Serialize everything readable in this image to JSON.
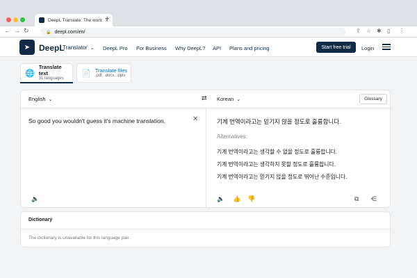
{
  "browser": {
    "tab_title": "DeepL Translate: The world's",
    "tab_close": "×",
    "new_tab": "+",
    "url": "deepl.com/en/"
  },
  "header": {
    "brand": "DeepL",
    "product": "Translator",
    "nav": [
      "DeepL Pro",
      "For Business",
      "Why DeepL?",
      "API",
      "Plans and pricing"
    ],
    "cta": "Start free trial",
    "login": "Login"
  },
  "modes": {
    "text": {
      "label": "Translate text",
      "sub": "31 languages"
    },
    "files": {
      "label": "Translate files",
      "sub": ".pdf, .docx, .pptx"
    }
  },
  "translator": {
    "source_lang": "English",
    "target_lang": "Korean",
    "glossary_label": "Glossary",
    "source_text": "So good you wouldn't guess it's machine translation.",
    "target_text": "기계 번역이라고는 믿기지 않을 정도로 훌륭합니다.",
    "alternatives_label": "Alternatives:",
    "alternatives": [
      "기계 번역이라고는 생각할 수 없을 정도로 훌륭합니다.",
      "기계 번역이라고는 생각하지 못할 정도로 훌륭합니다.",
      "기계 번역이라고는 믿기지 않을 정도로 뛰어난 수준입니다."
    ]
  },
  "dictionary": {
    "title": "Dictionary",
    "message": "The dictionary is unavailable for this language pair."
  },
  "colors": {
    "brand_navy": "#0f2b46",
    "link_blue": "#0f6ea8"
  }
}
